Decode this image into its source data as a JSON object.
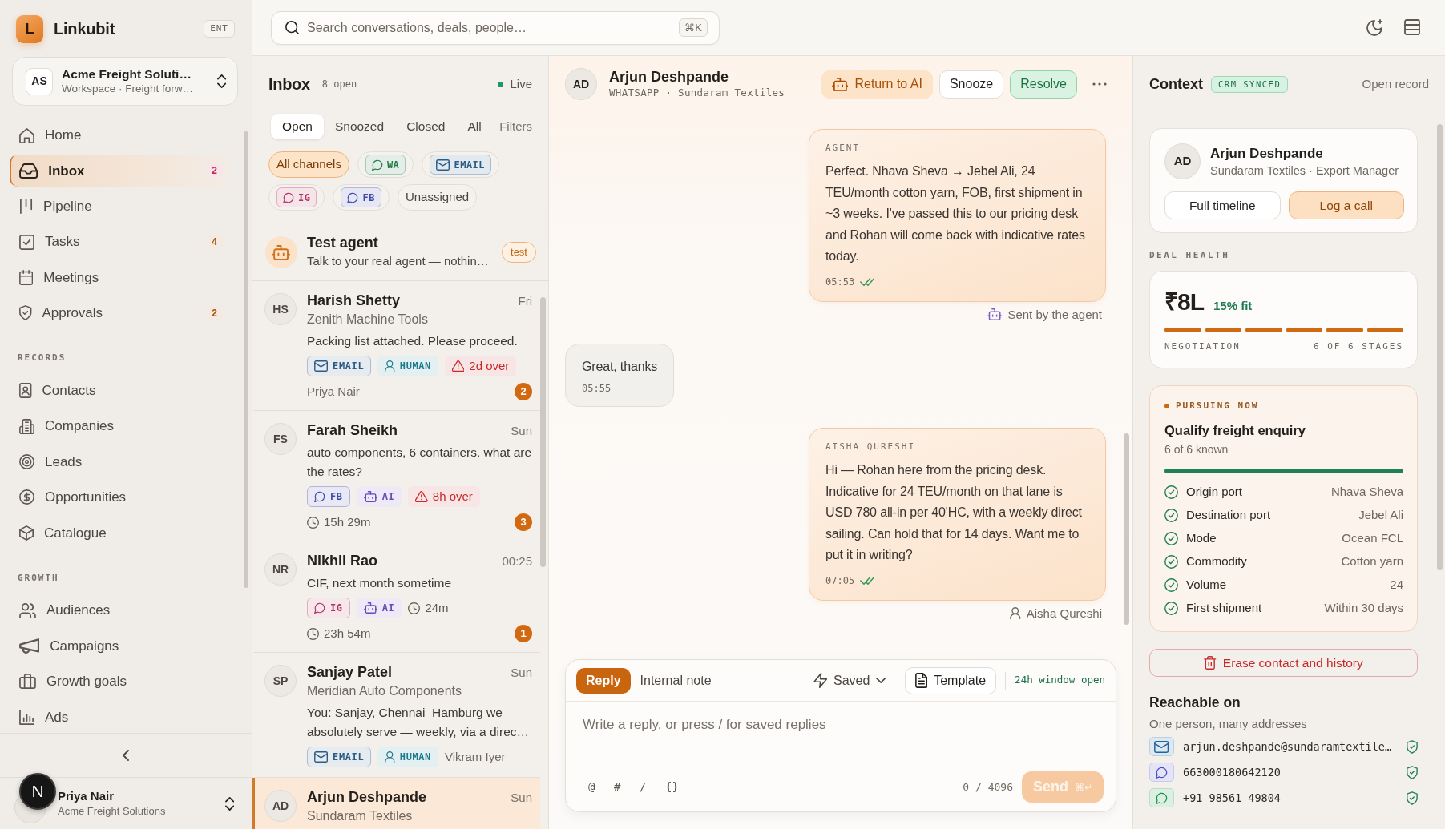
{
  "sidebar": {
    "brand": {
      "logo": "L",
      "name": "Linkubit",
      "plan": "ENT"
    },
    "workspace": {
      "initials": "AS",
      "name": "Acme Freight Soluti…",
      "subtitle": "Workspace · Freight forw…"
    },
    "nav_groups": [
      {
        "items": [
          {
            "label": "Home",
            "selected": false
          },
          {
            "label": "Inbox",
            "selected": true,
            "badge": {
              "text": "2",
              "color": "#c0264b"
            }
          },
          {
            "label": "Pipeline",
            "selected": false
          },
          {
            "label": "Tasks",
            "selected": false,
            "badge": {
              "text": "4",
              "color": "#a35208"
            }
          },
          {
            "label": "Meetings",
            "selected": false
          },
          {
            "label": "Approvals",
            "selected": false,
            "badge": {
              "text": "2",
              "color": "#a35208"
            }
          }
        ]
      },
      {
        "heading": "RECORDS",
        "items": [
          {
            "label": "Contacts",
            "selected": false
          },
          {
            "label": "Companies",
            "selected": false
          },
          {
            "label": "Leads",
            "selected": false
          },
          {
            "label": "Opportunities",
            "selected": false
          },
          {
            "label": "Catalogue",
            "selected": false
          }
        ]
      },
      {
        "heading": "GROWTH",
        "items": [
          {
            "label": "Audiences",
            "selected": false
          },
          {
            "label": "Campaigns",
            "selected": false
          },
          {
            "label": "Growth goals",
            "selected": false
          },
          {
            "label": "Ads",
            "selected": false
          }
        ]
      }
    ],
    "user": {
      "name": "Priya Nair",
      "organization": "Acme Freight Solutions"
    },
    "dev_indicator": {
      "label": "N"
    }
  },
  "topbar": {
    "search": {
      "placeholder": "Search conversations, deals, people…",
      "shortcut": "⌘K"
    }
  },
  "inbox": {
    "title": "Inbox",
    "open_count": "8 open",
    "live": "Live",
    "tabs": [
      {
        "label": "Open",
        "selected": true
      },
      {
        "label": "Snoozed",
        "selected": false
      },
      {
        "label": "Closed",
        "selected": false
      },
      {
        "label": "All",
        "selected": false
      }
    ],
    "filters": "Filters",
    "channel_filters": [
      {
        "label": "All channels",
        "kind": "plain",
        "selected": true
      },
      {
        "label": "WA",
        "kind": "chat",
        "color": "#237a45",
        "selected": false
      },
      {
        "label": "EMAIL",
        "kind": "mail",
        "color": "#2b5c86",
        "selected": false
      },
      {
        "label": "IG",
        "kind": "chat",
        "color": "#b0335f",
        "selected": false
      },
      {
        "label": "FB",
        "kind": "chat",
        "color": "#4049a8",
        "selected": false
      },
      {
        "label": "Unassigned",
        "kind": "plain",
        "selected": false
      }
    ],
    "test_agent": {
      "name": "Test agent",
      "preview": "Talk to your real agent — nothin…",
      "badge": "test"
    },
    "conversations": [
      {
        "initials": "HS",
        "name": "Harish Shetty",
        "time": "Fri",
        "company": "Zenith Machine Tools",
        "preview": "Packing list attached. Please proceed.",
        "tags": [
          {
            "kind": "mail",
            "label": "EMAIL",
            "color": "#2b5c86"
          },
          {
            "kind": "human",
            "label": "HUMAN",
            "color": "#1a7a8e"
          },
          {
            "kind": "overdue",
            "label": "2d over",
            "color": "#c62a2a"
          }
        ],
        "meta": [
          {
            "kind": "assignee",
            "label": "Priya Nair"
          }
        ],
        "unread": "2",
        "selected": false
      },
      {
        "initials": "FS",
        "name": "Farah Sheikh",
        "time": "Sun",
        "preview": "auto components, 6 containers. what are the rates?",
        "tags": [
          {
            "kind": "chat",
            "label": "FB",
            "color": "#4049a8"
          },
          {
            "kind": "ai",
            "label": "AI",
            "color": "#6b49b8"
          },
          {
            "kind": "overdue",
            "label": "8h over",
            "color": "#c62a2a"
          }
        ],
        "meta": [
          {
            "kind": "timer",
            "label": "15h 29m"
          }
        ],
        "unread": "3",
        "selected": false
      },
      {
        "initials": "NR",
        "name": "Nikhil Rao",
        "time": "00:25",
        "preview": "CIF, next month sometime",
        "tags": [
          {
            "kind": "chat",
            "label": "IG",
            "color": "#b0335f"
          },
          {
            "kind": "ai",
            "label": "AI",
            "color": "#6b49b8"
          },
          {
            "kind": "timer",
            "label": "24m"
          }
        ],
        "meta": [
          {
            "kind": "timer",
            "label": "23h 54m"
          }
        ],
        "unread": "1",
        "selected": false
      },
      {
        "initials": "SP",
        "name": "Sanjay Patel",
        "time": "Sun",
        "company": "Meridian Auto Components",
        "preview": "You: Sanjay, Chennai–Hamburg we absolutely serve — weekly, via a direc…",
        "tags": [
          {
            "kind": "mail",
            "label": "EMAIL",
            "color": "#2b5c86"
          },
          {
            "kind": "human",
            "label": "HUMAN",
            "color": "#1a7a8e"
          },
          {
            "kind": "assignee",
            "label": "Vikram Iyer"
          }
        ],
        "selected": false
      },
      {
        "initials": "AD",
        "name": "Arjun Deshpande",
        "time": "Sun",
        "company": "Sundaram Textiles",
        "selected": true
      }
    ]
  },
  "conversation": {
    "initials": "AD",
    "name": "Arjun Deshpande",
    "channel": "WHATSAPP · Sundaram Textiles",
    "actions": [
      {
        "label": "Return to AI",
        "kind": "accent"
      },
      {
        "label": "Snooze",
        "kind": "outline"
      },
      {
        "label": "Resolve",
        "kind": "success"
      }
    ],
    "messages": [
      {
        "kind": "outgoing",
        "sender": "AGENT",
        "text": "Perfect. Nhava Sheva → Jebel Ali, 24 TEU/month cotton yarn, FOB, first shipment in ~3 weeks. I've passed this to our pricing desk and Rohan will come back with indicative rates today.",
        "time": "05:53",
        "read": true,
        "attribution": {
          "kind": "agent",
          "text": "Sent by the agent"
        }
      },
      {
        "kind": "incoming",
        "text": "Great, thanks",
        "time": "05:55"
      },
      {
        "kind": "outgoing",
        "sender": "AISHA QURESHI",
        "text": "Hi — Rohan here from the pricing desk. Indicative for 24 TEU/month on that lane is USD 780 all-in per 40'HC, with a weekly direct sailing. Can hold that for 14 days. Want me to put it in writing?",
        "time": "07:05",
        "read": true,
        "attribution": {
          "kind": "human",
          "text": "Aisha Qureshi"
        }
      }
    ],
    "composer": {
      "modes": [
        {
          "label": "Reply",
          "selected": true
        },
        {
          "label": "Internal note",
          "selected": false
        }
      ],
      "saved": "Saved",
      "template": "Template",
      "window_status": "24h window open",
      "placeholder": "Write a reply, or press / for saved replies",
      "tools": [
        "@",
        "#",
        "/",
        "{}"
      ],
      "char_count": "0 / 4096",
      "send": {
        "label": "Send",
        "shortcut": "⌘↵",
        "disabled": true
      }
    }
  },
  "context": {
    "title": "Context",
    "sync_badge": "CRM SYNCED",
    "open_record": "Open record",
    "contact": {
      "initials": "AD",
      "name": "Arjun Deshpande",
      "subtitle": "Sundaram Textiles · Export Manager",
      "actions": [
        {
          "label": "Full timeline",
          "kind": "outline"
        },
        {
          "label": "Log a call",
          "kind": "accent"
        }
      ]
    },
    "deal_health": {
      "heading": "DEAL HEALTH",
      "value": "₹8L",
      "fit": "15% fit",
      "stages": [
        {
          "done": true
        },
        {
          "done": true
        },
        {
          "done": true
        },
        {
          "done": true
        },
        {
          "done": true
        },
        {
          "done": true
        }
      ],
      "stage_name": "NEGOTIATION",
      "stage_count": "6 OF 6 STAGES"
    },
    "pursuing": {
      "label": "PURSUING NOW",
      "title": "Qualify freight enquiry",
      "known": "6 of 6 known",
      "level": 1,
      "fields": [
        {
          "label": "Origin port",
          "value": "Nhava Sheva",
          "known": true
        },
        {
          "label": "Destination port",
          "value": "Jebel Ali",
          "known": true
        },
        {
          "label": "Mode",
          "value": "Ocean FCL",
          "known": true
        },
        {
          "label": "Commodity",
          "value": "Cotton yarn",
          "known": true
        },
        {
          "label": "Volume",
          "value": "24",
          "known": true
        },
        {
          "label": "First shipment",
          "value": "Within 30 days",
          "known": true
        }
      ]
    },
    "erase": "Erase contact and history",
    "reachable": {
      "title": "Reachable on",
      "subtitle": "One person, many addresses",
      "addresses": [
        {
          "kind": "mail",
          "value": "arjun.deshpande@sundaramtextile…",
          "color": "#dde8f1",
          "verified": true
        },
        {
          "kind": "chat",
          "value": "663000180642120",
          "color": "#e4e4f7",
          "verified": true
        },
        {
          "kind": "chat",
          "value": "+91 98561 49804",
          "color": "#dcefe3",
          "verified": true
        }
      ]
    }
  }
}
